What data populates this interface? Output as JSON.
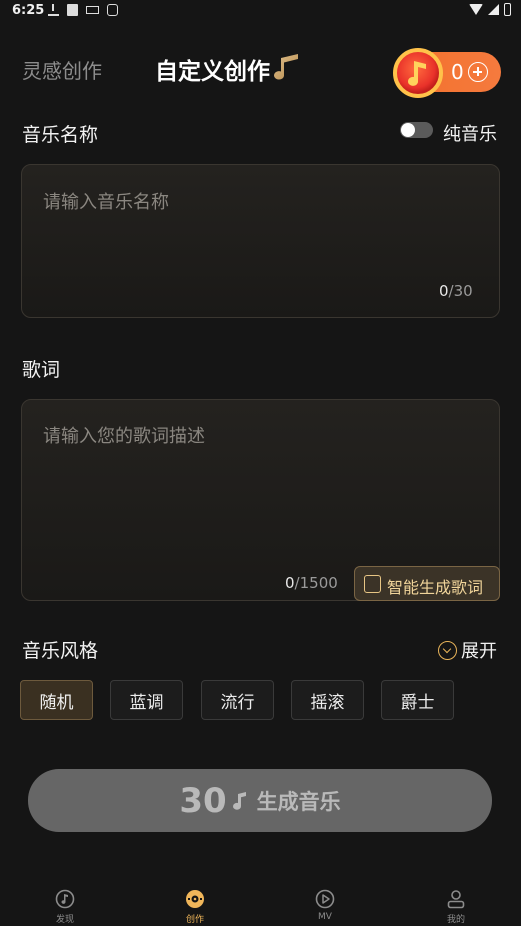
{
  "status_bar": {
    "time": "6:25"
  },
  "header": {
    "tab_inspire": "灵感创作",
    "tab_custom": "自定义创作",
    "coin_count": "0"
  },
  "name_section": {
    "label": "音乐名称",
    "pure_music_label": "纯音乐",
    "pure_music_on": false,
    "placeholder": "请输入音乐名称",
    "count_current": "0",
    "count_max": "/30"
  },
  "lyrics_section": {
    "label": "歌词",
    "placeholder": "请输入您的歌词描述",
    "count_current": "0",
    "count_max": "/1500",
    "ai_button": "智能生成歌词"
  },
  "style_section": {
    "label": "音乐风格",
    "expand": "展开",
    "chips": [
      "随机",
      "蓝调",
      "流行",
      "摇滚",
      "爵士"
    ],
    "selected": "随机"
  },
  "generate": {
    "cost": "30",
    "label": "生成音乐"
  },
  "nav": {
    "items": [
      {
        "label": "发现",
        "icon": "music-note-circle-icon"
      },
      {
        "label": "创作",
        "icon": "vinyl-disc-icon"
      },
      {
        "label": "MV",
        "icon": "play-circle-icon"
      },
      {
        "label": "我的",
        "icon": "person-icon"
      }
    ],
    "active": "创作"
  },
  "colors": {
    "accent": "#f0b65a",
    "coin_orange": "#f2712b",
    "background": "#151515"
  }
}
